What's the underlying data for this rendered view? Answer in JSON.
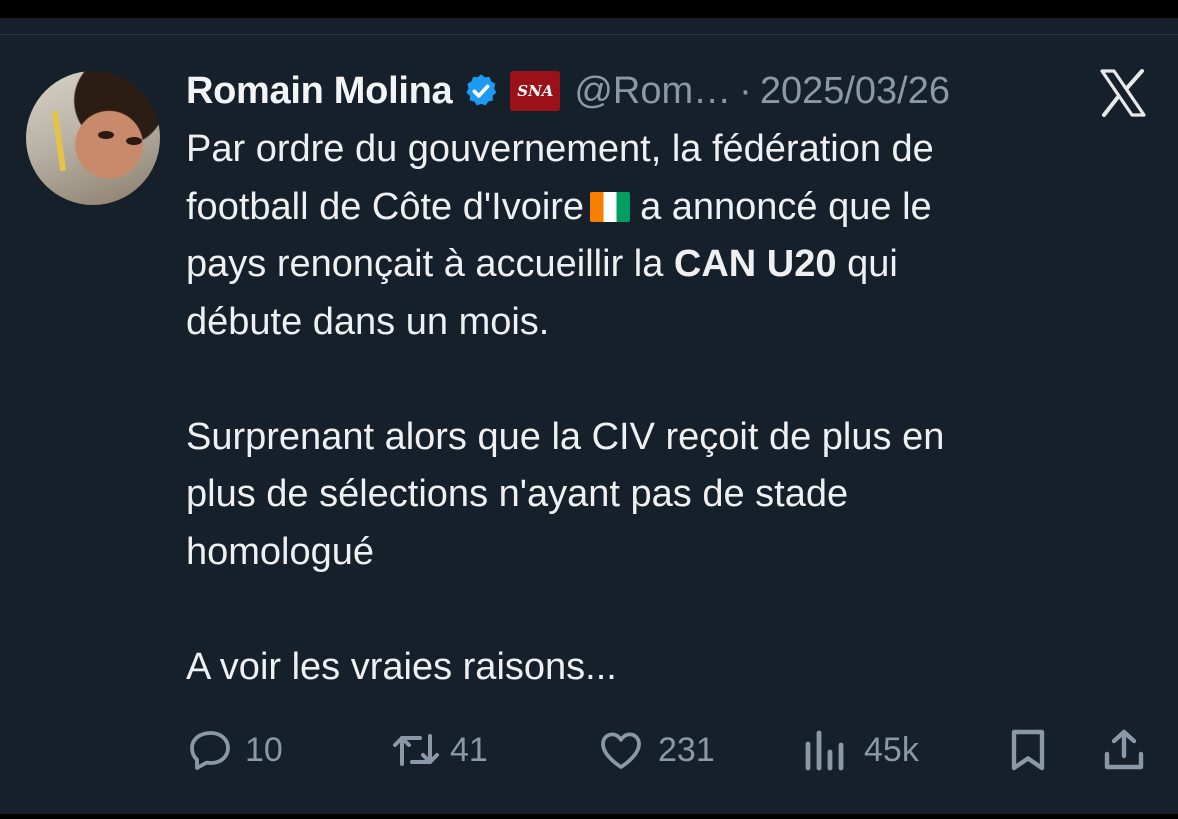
{
  "tweet": {
    "author_name": "Romain Molina",
    "handle": "@Rom…",
    "separator": "·",
    "date": "2025/03/26",
    "badge_text": "SNA",
    "line1": "Par ordre du gouvernement, la fédération de",
    "line2_pre": "football de Côte d'Ivoire",
    "line2_post": "a annoncé que le",
    "line3_pre": "pays renonçait à accueillir la ",
    "line3_bold": "CAN U20",
    "line3_post": " qui",
    "line4": "débute dans un mois.",
    "para2_line1": "Surprenant alors que la CIV reçoit de plus en",
    "para2_line2": "plus de sélections n'ayant pas de stade",
    "para2_line3": "homologué",
    "para3_line1": "A voir les vraies raisons..."
  },
  "actions": {
    "replies": "10",
    "retweets": "41",
    "likes": "231",
    "views": "45k"
  },
  "colors": {
    "background": "#15202b",
    "text": "#e7e9ea",
    "muted": "#8b98a5",
    "verified": "#1d9bf0"
  }
}
